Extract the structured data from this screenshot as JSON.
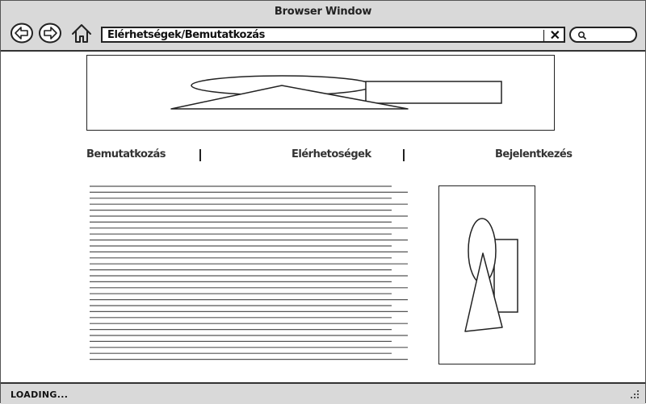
{
  "window": {
    "title": "Browser Window",
    "address": "Elérhetségek/Bemutatkozás",
    "clear_glyph": "✕",
    "status": "LOADING..."
  },
  "icons": {
    "back": "back-arrow-icon",
    "forward": "forward-arrow-icon",
    "home": "home-icon",
    "clear": "close-icon",
    "search": "search-icon",
    "resize": "resize-grip-icon"
  },
  "nav": {
    "items": [
      "Bemutatkozás",
      "Elérhetoségek",
      "Bejelentkezés"
    ],
    "separator": "|"
  },
  "main": {
    "banner_image": "image-placeholder",
    "text_block": "text-lines-placeholder",
    "side_image": "image-placeholder"
  },
  "colors": {
    "chrome": "#d9d9d9",
    "stroke": "#222222",
    "background": "#ffffff"
  }
}
